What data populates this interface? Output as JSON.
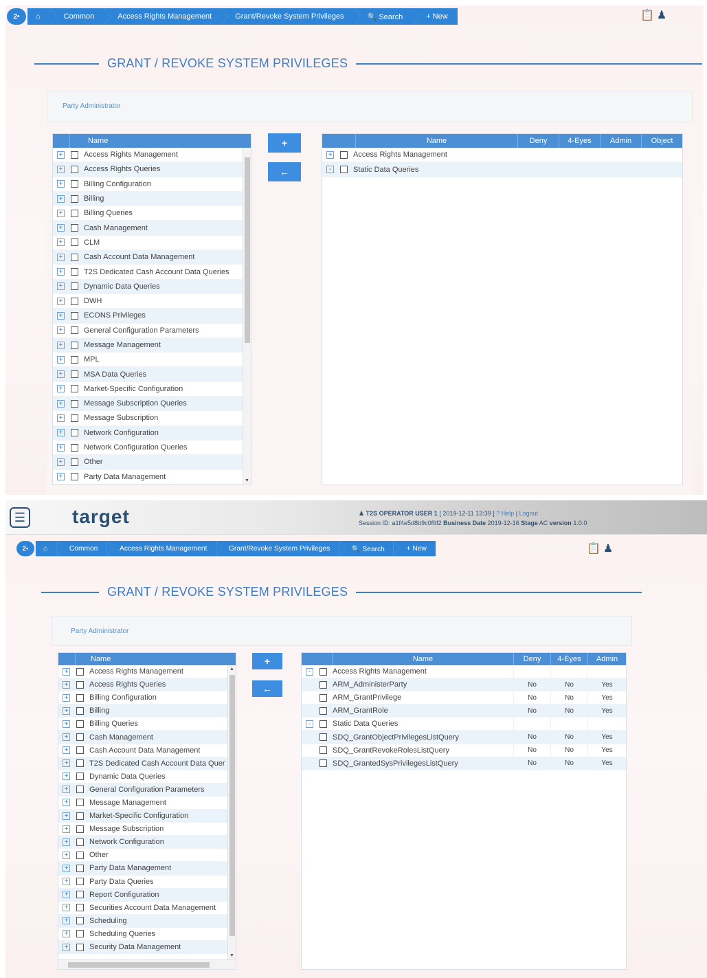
{
  "breadcrumb": {
    "home_badge": "2•",
    "items": [
      "⌂",
      "Common",
      "Access Rights Management",
      "Grant/Revoke System Privileges",
      "🔍 Search",
      "+ New"
    ]
  },
  "page": {
    "title": "GRANT / REVOKE SYSTEM PRIVILEGES",
    "party_label": "Party Administrator"
  },
  "buttons": {
    "add": "+",
    "remove": "←"
  },
  "left_grid": {
    "header": "Name",
    "items_top": [
      "Access Rights Management",
      "Access Rights Queries",
      "Billing Configuration",
      "Billing",
      "Billing Queries",
      "Cash Management",
      "CLM",
      "Cash Account Data Management",
      "T2S Dedicated Cash Account Data Queries",
      "Dynamic Data Queries",
      "DWH",
      "ECONS Privileges",
      "General Configuration Parameters",
      "Message Management",
      "MPL",
      "MSA Data Queries",
      "Market-Specific Configuration",
      "Message Subscription Queries",
      "Message Subscription",
      "Network Configuration",
      "Network Configuration Queries",
      "Other",
      "Party Data Management"
    ],
    "items_bottom": [
      "Access Rights Management",
      "Access Rights Queries",
      "Billing Configuration",
      "Billing",
      "Billing Queries",
      "Cash Management",
      "Cash Account Data Management",
      "T2S Dedicated Cash Account Data Quer",
      "Dynamic Data Queries",
      "General Configuration Parameters",
      "Message Management",
      "Market-Specific Configuration",
      "Message Subscription",
      "Network Configuration",
      "Other",
      "Party Data Management",
      "Party Data Queries",
      "Report Configuration",
      "Securities Account Data Management",
      "Scheduling",
      "Scheduling Queries",
      "Security Data Management"
    ]
  },
  "right_grid_top": {
    "headers": [
      "Name",
      "Deny",
      "4-Eyes",
      "Admin",
      "Object"
    ],
    "rows": [
      {
        "name": "Access Rights Management",
        "expander": "+"
      },
      {
        "name": "Static Data Queries",
        "expander": "-"
      }
    ]
  },
  "right_grid_bottom": {
    "headers": [
      "Name",
      "Deny",
      "4-Eyes",
      "Admin"
    ],
    "rows": [
      {
        "name": "Access Rights Management",
        "group": true,
        "deny": "",
        "eyes": "",
        "admin": ""
      },
      {
        "name": "ARM_AdministerParty",
        "group": false,
        "deny": "No",
        "eyes": "No",
        "admin": "Yes"
      },
      {
        "name": "ARM_GrantPrivilege",
        "group": false,
        "deny": "No",
        "eyes": "No",
        "admin": "Yes"
      },
      {
        "name": "ARM_GrantRole",
        "group": false,
        "deny": "No",
        "eyes": "No",
        "admin": "Yes"
      },
      {
        "name": "Static Data Queries",
        "group": true,
        "deny": "",
        "eyes": "",
        "admin": ""
      },
      {
        "name": "SDQ_GrantObjectPrivilegesListQuery",
        "group": false,
        "deny": "No",
        "eyes": "No",
        "admin": "Yes"
      },
      {
        "name": "SDQ_GrantRevokeRolesListQuery",
        "group": false,
        "deny": "No",
        "eyes": "No",
        "admin": "Yes"
      },
      {
        "name": "SDQ_GrantedSysPrivilegesListQuery",
        "group": false,
        "deny": "No",
        "eyes": "No",
        "admin": "Yes"
      }
    ]
  },
  "header": {
    "brand": "target",
    "user": "T2S OPERATOR USER 1",
    "datetime": "[ 2019-12-11 13:39 ]",
    "help": "? Help",
    "logout": "Logout",
    "session": "Session ID: a1f4e5d8b9c0f6f2",
    "business_date_label": "Business Date",
    "business_date": "2019-12-16",
    "stage_label": "Stage",
    "stage": "AC",
    "version_label": "version",
    "version": "1.0.0"
  },
  "colors": {
    "accent": "#3c7fc6",
    "header_bar": "#4d8fd4",
    "button": "#3d8de0"
  }
}
